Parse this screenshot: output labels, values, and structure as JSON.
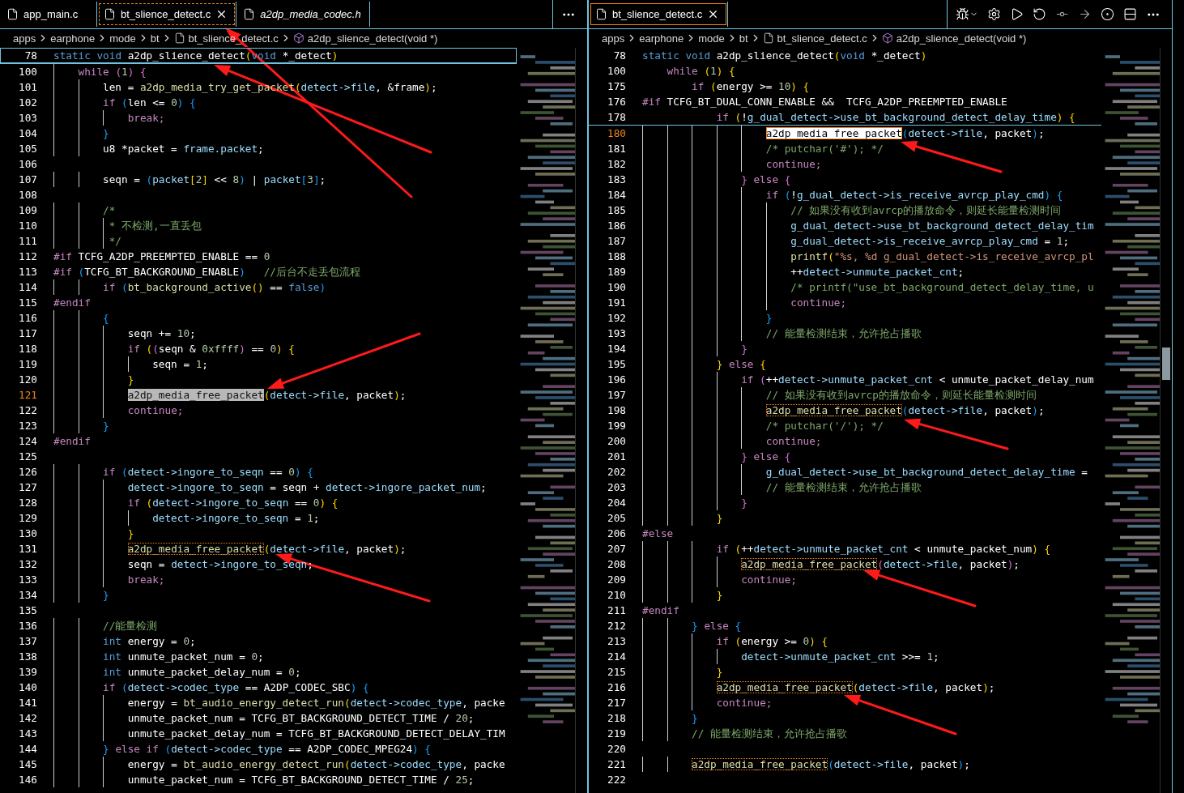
{
  "editor_groups": [
    {
      "focused": true,
      "tabs": [
        {
          "label": "app_main.c",
          "selected": false,
          "preview": false
        },
        {
          "label": "bt_slience_detect.c",
          "selected": true,
          "preview": false
        },
        {
          "label": "a2dp_media_codec.h",
          "selected": false,
          "preview": true
        }
      ],
      "actions": [
        {
          "kind": "more"
        }
      ],
      "breadcrumbs": [
        {
          "text": "apps",
          "kind": "folder"
        },
        {
          "text": "earphone",
          "kind": "folder"
        },
        {
          "text": "mode",
          "kind": "folder"
        },
        {
          "text": "bt",
          "kind": "folder"
        },
        {
          "text": "bt_slience_detect.c",
          "kind": "file"
        },
        {
          "text": "a2dp_slience_detect(void *)",
          "kind": "symbol"
        }
      ],
      "sticky_lines": [
        {
          "number": "78",
          "current": false,
          "tokens": [
            {
              "text": "static void",
              "kind": "kw"
            },
            {
              "text": " a2dp_slience_detect",
              "kind": "txt"
            },
            {
              "text": "(",
              "kind": "b1"
            },
            {
              "text": "void",
              "kind": "kw"
            },
            {
              "text": " *_detect",
              "kind": "txt"
            },
            {
              "text": ")",
              "kind": "b1"
            }
          ]
        }
      ],
      "lines": [
        {
          "number": "100",
          "current": false,
          "tokens": [
            {
              "text": "    while",
              "kind": "ctl"
            },
            {
              "text": " (",
              "kind": "b2"
            },
            {
              "text": "1",
              "kind": "num"
            },
            {
              "text": ") {",
              "kind": "b2"
            }
          ]
        },
        {
          "number": "101",
          "current": false,
          "tokens": [
            {
              "text": "        len = ",
              "kind": "txt"
            },
            {
              "text": "a2dp_media_try_get_packet",
              "kind": "fn"
            },
            {
              "text": "(",
              "kind": "b1"
            },
            {
              "text": "detect->file",
              "kind": "var"
            },
            {
              "text": ", &frame",
              "kind": "txt"
            },
            {
              "text": ")",
              "kind": "b1"
            },
            {
              "text": ";",
              "kind": "txt"
            }
          ]
        },
        {
          "number": "102",
          "current": false,
          "tokens": [
            {
              "text": "        if",
              "kind": "ctl"
            },
            {
              "text": " (",
              "kind": "b3"
            },
            {
              "text": "len <= ",
              "kind": "txt"
            },
            {
              "text": "0",
              "kind": "num"
            },
            {
              "text": ") {",
              "kind": "b3"
            }
          ]
        },
        {
          "number": "103",
          "current": false,
          "tokens": [
            {
              "text": "            break;",
              "kind": "ctl"
            }
          ]
        },
        {
          "number": "104",
          "current": false,
          "tokens": [
            {
              "text": "        }",
              "kind": "b3"
            }
          ]
        },
        {
          "number": "105",
          "current": false,
          "tokens": [
            {
              "text": "        u8 *packet = ",
              "kind": "txt"
            },
            {
              "text": "frame.packet",
              "kind": "var"
            },
            {
              "text": ";",
              "kind": "txt"
            }
          ]
        },
        {
          "number": "106",
          "current": false
        },
        {
          "number": "107",
          "current": false,
          "tokens": [
            {
              "text": "        seqn = ",
              "kind": "txt"
            },
            {
              "text": "(",
              "kind": "b3"
            },
            {
              "text": "packet",
              "kind": "var"
            },
            {
              "text": "[",
              "kind": "b1"
            },
            {
              "text": "2",
              "kind": "num"
            },
            {
              "text": "]",
              "kind": "b1"
            },
            {
              "text": " << ",
              "kind": "txt"
            },
            {
              "text": "8",
              "kind": "num"
            },
            {
              "text": ")",
              "kind": "b3"
            },
            {
              "text": " | ",
              "kind": "txt"
            },
            {
              "text": "packet",
              "kind": "var"
            },
            {
              "text": "[",
              "kind": "b3"
            },
            {
              "text": "3",
              "kind": "num"
            },
            {
              "text": "]",
              "kind": "b3"
            },
            {
              "text": ";",
              "kind": "txt"
            }
          ]
        },
        {
          "number": "108",
          "current": false
        },
        {
          "number": "109",
          "current": false,
          "tokens": [
            {
              "text": "        /*",
              "kind": "com"
            }
          ]
        },
        {
          "number": "110",
          "current": false,
          "tokens": [
            {
              "text": "         * 不检测,一直丢包",
              "kind": "com"
            }
          ]
        },
        {
          "number": "111",
          "current": false,
          "tokens": [
            {
              "text": "         */",
              "kind": "com"
            }
          ]
        },
        {
          "number": "112",
          "current": false,
          "tokens": [
            {
              "text": "#if",
              "kind": "pre"
            },
            {
              "text": " TCFG_A2DP_PREEMPTED_ENABLE == ",
              "kind": "txt"
            },
            {
              "text": "0",
              "kind": "num"
            }
          ]
        },
        {
          "number": "113",
          "current": false,
          "tokens": [
            {
              "text": "#if",
              "kind": "pre"
            },
            {
              "text": " (",
              "kind": "b3"
            },
            {
              "text": "TCFG_BT_BACKGROUND_ENABLE",
              "kind": "txt"
            },
            {
              "text": ")",
              "kind": "b3"
            },
            {
              "text": "   //后台不走丢包流程",
              "kind": "com"
            }
          ]
        },
        {
          "number": "114",
          "current": false,
          "tokens": [
            {
              "text": "        if",
              "kind": "ctl"
            },
            {
              "text": " (",
              "kind": "b3"
            },
            {
              "text": "bt_background_active",
              "kind": "fn"
            },
            {
              "text": "()",
              "kind": "b1"
            },
            {
              "text": " == ",
              "kind": "txt"
            },
            {
              "text": "false",
              "kind": "kw"
            },
            {
              "text": ")",
              "kind": "b3"
            }
          ]
        },
        {
          "number": "115",
          "current": false,
          "tokens": [
            {
              "text": "#endif",
              "kind": "pre"
            }
          ]
        },
        {
          "number": "116",
          "current": false,
          "tokens": [
            {
              "text": "        {",
              "kind": "b3"
            }
          ]
        },
        {
          "number": "117",
          "current": false,
          "tokens": [
            {
              "text": "            seqn += ",
              "kind": "txt"
            },
            {
              "text": "10",
              "kind": "num"
            },
            {
              "text": ";",
              "kind": "txt"
            }
          ]
        },
        {
          "number": "118",
          "current": false,
          "tokens": [
            {
              "text": "            if",
              "kind": "ctl"
            },
            {
              "text": " (",
              "kind": "b1"
            },
            {
              "text": "(",
              "kind": "b2"
            },
            {
              "text": "seqn & ",
              "kind": "txt"
            },
            {
              "text": "0xffff",
              "kind": "num"
            },
            {
              "text": ")",
              "kind": "b2"
            },
            {
              "text": " == ",
              "kind": "txt"
            },
            {
              "text": "0",
              "kind": "num"
            },
            {
              "text": ") {",
              "kind": "b1"
            }
          ]
        },
        {
          "number": "119",
          "current": false,
          "tokens": [
            {
              "text": "                seqn = ",
              "kind": "txt"
            },
            {
              "text": "1",
              "kind": "num"
            },
            {
              "text": ";",
              "kind": "txt"
            }
          ]
        },
        {
          "number": "120",
          "current": false,
          "tokens": [
            {
              "text": "            }",
              "kind": "b1"
            }
          ]
        },
        {
          "number": "121",
          "current": true,
          "tokens": [
            {
              "text": "            a2dp_media_free_packet",
              "kind": "sel"
            },
            {
              "text": "(",
              "kind": "b1"
            },
            {
              "text": "detect->file",
              "kind": "var"
            },
            {
              "text": ", packet",
              "kind": "txt"
            },
            {
              "text": ")",
              "kind": "b1"
            },
            {
              "text": ";",
              "kind": "txt"
            }
          ]
        },
        {
          "number": "122",
          "current": false,
          "tokens": [
            {
              "text": "            continue;",
              "kind": "ctl"
            }
          ]
        },
        {
          "number": "123",
          "current": false,
          "tokens": [
            {
              "text": "        }",
              "kind": "b3"
            }
          ]
        },
        {
          "number": "124",
          "current": false,
          "tokens": [
            {
              "text": "#endif",
              "kind": "pre"
            }
          ]
        },
        {
          "number": "125",
          "current": false
        },
        {
          "number": "126",
          "current": false,
          "tokens": [
            {
              "text": "        if",
              "kind": "ctl"
            },
            {
              "text": " (",
              "kind": "b3"
            },
            {
              "text": "detect->ingore_to_seqn",
              "kind": "var"
            },
            {
              "text": " == ",
              "kind": "txt"
            },
            {
              "text": "0",
              "kind": "num"
            },
            {
              "text": ") {",
              "kind": "b3"
            }
          ]
        },
        {
          "number": "127",
          "current": false,
          "tokens": [
            {
              "text": "            detect->ingore_to_seqn",
              "kind": "var"
            },
            {
              "text": " = seqn + ",
              "kind": "txt"
            },
            {
              "text": "detect->ingore_packet_num",
              "kind": "var"
            },
            {
              "text": ";",
              "kind": "txt"
            }
          ]
        },
        {
          "number": "128",
          "current": false,
          "tokens": [
            {
              "text": "            if",
              "kind": "ctl"
            },
            {
              "text": " (",
              "kind": "b1"
            },
            {
              "text": "detect->ingore_to_seqn",
              "kind": "var"
            },
            {
              "text": " == ",
              "kind": "txt"
            },
            {
              "text": "0",
              "kind": "num"
            },
            {
              "text": ") {",
              "kind": "b1"
            }
          ]
        },
        {
          "number": "129",
          "current": false,
          "tokens": [
            {
              "text": "                detect->ingore_to_seqn",
              "kind": "var"
            },
            {
              "text": " = ",
              "kind": "txt"
            },
            {
              "text": "1",
              "kind": "num"
            },
            {
              "text": ";",
              "kind": "txt"
            }
          ]
        },
        {
          "number": "130",
          "current": false,
          "tokens": [
            {
              "text": "            }",
              "kind": "b1"
            }
          ]
        },
        {
          "number": "131",
          "current": false,
          "tokens": [
            {
              "text": "            a2dp_media_free_packet",
              "kind": "match"
            },
            {
              "text": "(",
              "kind": "b1"
            },
            {
              "text": "detect->file",
              "kind": "var"
            },
            {
              "text": ", packet",
              "kind": "txt"
            },
            {
              "text": ")",
              "kind": "b1"
            },
            {
              "text": ";",
              "kind": "txt"
            }
          ]
        },
        {
          "number": "132",
          "current": false,
          "tokens": [
            {
              "text": "            seqn = ",
              "kind": "txt"
            },
            {
              "text": "detect->ingore_to_seqn",
              "kind": "var"
            },
            {
              "text": ";",
              "kind": "txt"
            }
          ]
        },
        {
          "number": "133",
          "current": false,
          "tokens": [
            {
              "text": "            break;",
              "kind": "ctl"
            }
          ]
        },
        {
          "number": "134",
          "current": false,
          "tokens": [
            {
              "text": "        }",
              "kind": "b3"
            }
          ]
        },
        {
          "number": "135",
          "current": false
        },
        {
          "number": "136",
          "current": false,
          "tokens": [
            {
              "text": "        //能量检测",
              "kind": "com"
            }
          ]
        },
        {
          "number": "137",
          "current": false,
          "tokens": [
            {
              "text": "        int",
              "kind": "kw"
            },
            {
              "text": " energy = ",
              "kind": "txt"
            },
            {
              "text": "0",
              "kind": "num"
            },
            {
              "text": ";",
              "kind": "txt"
            }
          ]
        },
        {
          "number": "138",
          "current": false,
          "tokens": [
            {
              "text": "        int",
              "kind": "kw"
            },
            {
              "text": " unmute_packet_num = ",
              "kind": "txt"
            },
            {
              "text": "0",
              "kind": "num"
            },
            {
              "text": ";",
              "kind": "txt"
            }
          ]
        },
        {
          "number": "139",
          "current": false,
          "tokens": [
            {
              "text": "        int",
              "kind": "kw"
            },
            {
              "text": " unmute_packet_delay_num = ",
              "kind": "txt"
            },
            {
              "text": "0",
              "kind": "num"
            },
            {
              "text": ";",
              "kind": "txt"
            }
          ]
        },
        {
          "number": "140",
          "current": false,
          "tokens": [
            {
              "text": "        if",
              "kind": "ctl"
            },
            {
              "text": " (",
              "kind": "b3"
            },
            {
              "text": "detect->codec_type",
              "kind": "var"
            },
            {
              "text": " == A2DP_CODEC_SBC",
              "kind": "txt"
            },
            {
              "text": ") {",
              "kind": "b3"
            }
          ]
        },
        {
          "number": "141",
          "current": false,
          "tokens": [
            {
              "text": "            energy = ",
              "kind": "txt"
            },
            {
              "text": "bt_audio_energy_detect_run",
              "kind": "fn"
            },
            {
              "text": "(",
              "kind": "b1"
            },
            {
              "text": "detect->codec_type",
              "kind": "var"
            },
            {
              "text": ", packe",
              "kind": "txt"
            }
          ]
        },
        {
          "number": "142",
          "current": false,
          "tokens": [
            {
              "text": "            unmute_packet_num = TCFG_BT_BACKGROUND_DETECT_TIME / ",
              "kind": "txt"
            },
            {
              "text": "20",
              "kind": "num"
            },
            {
              "text": ";",
              "kind": "txt"
            }
          ]
        },
        {
          "number": "143",
          "current": false,
          "tokens": [
            {
              "text": "            unmute_packet_delay_num = TCFG_BT_BACKGROUND_DETECT_DELAY_TIM",
              "kind": "txt"
            }
          ]
        },
        {
          "number": "144",
          "current": false,
          "tokens": [
            {
              "text": "        } ",
              "kind": "b3"
            },
            {
              "text": "else if",
              "kind": "ctl"
            },
            {
              "text": " (",
              "kind": "b3"
            },
            {
              "text": "detect->codec_type",
              "kind": "var"
            },
            {
              "text": " == A2DP_CODEC_MPEG24",
              "kind": "txt"
            },
            {
              "text": ") {",
              "kind": "b3"
            }
          ]
        },
        {
          "number": "145",
          "current": false,
          "tokens": [
            {
              "text": "            energy = ",
              "kind": "txt"
            },
            {
              "text": "bt_audio_energy_detect_run",
              "kind": "fn"
            },
            {
              "text": "(",
              "kind": "b1"
            },
            {
              "text": "detect->codec_type",
              "kind": "var"
            },
            {
              "text": ", packe",
              "kind": "txt"
            }
          ]
        },
        {
          "number": "146",
          "current": false,
          "tokens": [
            {
              "text": "            unmute_packet_num = TCFG_BT_BACKGROUND_DETECT_TIME / ",
              "kind": "txt"
            },
            {
              "text": "25",
              "kind": "num"
            },
            {
              "text": ";",
              "kind": "txt"
            }
          ]
        }
      ]
    },
    {
      "focused": false,
      "tabs": [
        {
          "label": "bt_slience_detect.c",
          "selected": true,
          "preview": false
        }
      ],
      "actions": [
        {
          "kind": "debug"
        },
        {
          "kind": "settings"
        },
        {
          "kind": "run"
        },
        {
          "kind": "restart"
        },
        {
          "kind": "step-over"
        },
        {
          "kind": "step-into"
        },
        {
          "kind": "timeline"
        },
        {
          "kind": "split"
        },
        {
          "kind": "more"
        }
      ],
      "breadcrumbs": [
        {
          "text": "apps",
          "kind": "folder"
        },
        {
          "text": "earphone",
          "kind": "folder"
        },
        {
          "text": "mode",
          "kind": "folder"
        },
        {
          "text": "bt",
          "kind": "folder"
        },
        {
          "text": "bt_slience_detect.c",
          "kind": "file"
        },
        {
          "text": "a2dp_slience_detect(void *)",
          "kind": "symbol"
        }
      ],
      "sticky_lines": [
        {
          "number": "78",
          "current": false,
          "tokens": [
            {
              "text": "static void",
              "kind": "kw"
            },
            {
              "text": " a2dp_slience_detect",
              "kind": "txt"
            },
            {
              "text": "(",
              "kind": "b1"
            },
            {
              "text": "void",
              "kind": "kw"
            },
            {
              "text": " *_detect",
              "kind": "txt"
            },
            {
              "text": ")",
              "kind": "b1"
            }
          ]
        },
        {
          "number": "100",
          "current": false,
          "tokens": [
            {
              "text": "    while",
              "kind": "ctl"
            },
            {
              "text": " (",
              "kind": "b1"
            },
            {
              "text": "1",
              "kind": "num"
            },
            {
              "text": ") {",
              "kind": "b1"
            }
          ]
        },
        {
          "number": "175",
          "current": false,
          "tokens": [
            {
              "text": "        if",
              "kind": "ctl"
            },
            {
              "text": " (",
              "kind": "b1"
            },
            {
              "text": "energy >= ",
              "kind": "txt"
            },
            {
              "text": "10",
              "kind": "num"
            },
            {
              "text": ") {",
              "kind": "b1"
            }
          ]
        },
        {
          "number": "176",
          "current": false,
          "tokens": [
            {
              "text": "#if",
              "kind": "pre"
            },
            {
              "text": " TCFG_BT_DUAL_CONN_ENABLE &&  TCFG_A2DP_PREEMPTED_ENABLE",
              "kind": "txt"
            }
          ]
        },
        {
          "number": "178",
          "current": false,
          "tokens": [
            {
              "text": "            if",
              "kind": "ctl"
            },
            {
              "text": " (",
              "kind": "b1"
            },
            {
              "text": "!",
              "kind": "txt"
            },
            {
              "text": "g_dual_detect->use_bt_background_detect_delay_time",
              "kind": "var"
            },
            {
              "text": ") {",
              "kind": "b1"
            }
          ]
        }
      ],
      "lines": [
        {
          "number": "180",
          "current": true,
          "tokens": [
            {
              "text": "                    a2dp_media_free_packet",
              "kind": "focus"
            },
            {
              "text": "(",
              "kind": "b3"
            },
            {
              "text": "detect->file",
              "kind": "var"
            },
            {
              "text": ", packet",
              "kind": "txt"
            },
            {
              "text": ")",
              "kind": "b3"
            },
            {
              "text": ";",
              "kind": "txt"
            }
          ]
        },
        {
          "number": "181",
          "current": false,
          "tokens": [
            {
              "text": "                    /* putchar('#'); */",
              "kind": "com"
            }
          ]
        },
        {
          "number": "182",
          "current": false,
          "tokens": [
            {
              "text": "                    continue;",
              "kind": "ctl"
            }
          ]
        },
        {
          "number": "183",
          "current": false,
          "tokens": [
            {
              "text": "                } ",
              "kind": "b2"
            },
            {
              "text": "else",
              "kind": "ctl"
            },
            {
              "text": " {",
              "kind": "b2"
            }
          ]
        },
        {
          "number": "184",
          "current": false,
          "tokens": [
            {
              "text": "                    if",
              "kind": "ctl"
            },
            {
              "text": " (",
              "kind": "b3"
            },
            {
              "text": "!",
              "kind": "txt"
            },
            {
              "text": "g_dual_detect->is_receive_avrcp_play_cmd",
              "kind": "var"
            },
            {
              "text": ") {",
              "kind": "b3"
            }
          ]
        },
        {
          "number": "185",
          "current": false,
          "tokens": [
            {
              "text": "                        // 如果没有收到avrcp的播放命令，则延长能量检测时间",
              "kind": "com"
            }
          ]
        },
        {
          "number": "186",
          "current": false,
          "tokens": [
            {
              "text": "                        g_dual_detect->use_bt_background_detect_delay_tim",
              "kind": "var"
            }
          ]
        },
        {
          "number": "187",
          "current": false,
          "tokens": [
            {
              "text": "                        g_dual_detect->is_receive_avrcp_play_cmd",
              "kind": "var"
            },
            {
              "text": " = ",
              "kind": "txt"
            },
            {
              "text": "1",
              "kind": "num"
            },
            {
              "text": ";",
              "kind": "txt"
            }
          ]
        },
        {
          "number": "188",
          "current": false,
          "tokens": [
            {
              "text": "                        printf",
              "kind": "fn"
            },
            {
              "text": "(",
              "kind": "b1"
            },
            {
              "text": "\"%s, %d g_dual_detect->is_receive_avrcp_pl",
              "kind": "str"
            }
          ]
        },
        {
          "number": "189",
          "current": false,
          "tokens": [
            {
              "text": "                        ++",
              "kind": "txt"
            },
            {
              "text": "detect->unmute_packet_cnt",
              "kind": "var"
            },
            {
              "text": ";",
              "kind": "txt"
            }
          ]
        },
        {
          "number": "190",
          "current": false,
          "tokens": [
            {
              "text": "                        /* printf(\"use_bt_background_detect_delay_time, u",
              "kind": "com"
            }
          ]
        },
        {
          "number": "191",
          "current": false,
          "tokens": [
            {
              "text": "                        continue;",
              "kind": "ctl"
            }
          ]
        },
        {
          "number": "192",
          "current": false,
          "tokens": [
            {
              "text": "                    }",
              "kind": "b3"
            }
          ]
        },
        {
          "number": "193",
          "current": false,
          "tokens": [
            {
              "text": "                    // 能量检测结束，允许抢占播歌",
              "kind": "com"
            }
          ]
        },
        {
          "number": "194",
          "current": false,
          "tokens": [
            {
              "text": "                }",
              "kind": "b2"
            }
          ]
        },
        {
          "number": "195",
          "current": false,
          "tokens": [
            {
              "text": "            } ",
              "kind": "b1"
            },
            {
              "text": "else",
              "kind": "ctl"
            },
            {
              "text": " {",
              "kind": "b1"
            }
          ]
        },
        {
          "number": "196",
          "current": false,
          "tokens": [
            {
              "text": "                if",
              "kind": "ctl"
            },
            {
              "text": " (",
              "kind": "b2"
            },
            {
              "text": "++",
              "kind": "txt"
            },
            {
              "text": "detect->unmute_packet_cnt",
              "kind": "var"
            },
            {
              "text": " < unmute_packet_delay_num",
              "kind": "txt"
            }
          ]
        },
        {
          "number": "197",
          "current": false,
          "tokens": [
            {
              "text": "                    // 如果没有收到avrcp的播放命令，则延长能量检测时间",
              "kind": "com"
            }
          ]
        },
        {
          "number": "198",
          "current": false,
          "tokens": [
            {
              "text": "                    a2dp_media_free_packet",
              "kind": "match"
            },
            {
              "text": "(",
              "kind": "b3"
            },
            {
              "text": "detect->file",
              "kind": "var"
            },
            {
              "text": ", packet",
              "kind": "txt"
            },
            {
              "text": ")",
              "kind": "b3"
            },
            {
              "text": ";",
              "kind": "txt"
            }
          ]
        },
        {
          "number": "199",
          "current": false,
          "tokens": [
            {
              "text": "                    /* putchar('/'); */",
              "kind": "com"
            }
          ]
        },
        {
          "number": "200",
          "current": false,
          "tokens": [
            {
              "text": "                    continue;",
              "kind": "ctl"
            }
          ]
        },
        {
          "number": "201",
          "current": false,
          "tokens": [
            {
              "text": "                } ",
              "kind": "b2"
            },
            {
              "text": "else",
              "kind": "ctl"
            },
            {
              "text": " {",
              "kind": "b2"
            }
          ]
        },
        {
          "number": "202",
          "current": false,
          "tokens": [
            {
              "text": "                    g_dual_detect->use_bt_background_detect_delay_time",
              "kind": "var"
            },
            {
              "text": " =",
              "kind": "txt"
            }
          ]
        },
        {
          "number": "203",
          "current": false,
          "tokens": [
            {
              "text": "                    // 能量检测结束，允许抢占播歌",
              "kind": "com"
            }
          ]
        },
        {
          "number": "204",
          "current": false,
          "tokens": [
            {
              "text": "                }",
              "kind": "b2"
            }
          ]
        },
        {
          "number": "205",
          "current": false,
          "tokens": [
            {
              "text": "            }",
              "kind": "b1"
            }
          ]
        },
        {
          "number": "206",
          "current": false,
          "tokens": [
            {
              "text": "#else",
              "kind": "pre"
            }
          ]
        },
        {
          "number": "207",
          "current": false,
          "tokens": [
            {
              "text": "            if",
              "kind": "ctl"
            },
            {
              "text": " (",
              "kind": "b1"
            },
            {
              "text": "++",
              "kind": "txt"
            },
            {
              "text": "detect->unmute_packet_cnt",
              "kind": "var"
            },
            {
              "text": " < unmute_packet_num",
              "kind": "txt"
            },
            {
              "text": ") {",
              "kind": "b1"
            }
          ]
        },
        {
          "number": "208",
          "current": false,
          "tokens": [
            {
              "text": "                a2dp_media_free_packet",
              "kind": "match"
            },
            {
              "text": "(",
              "kind": "b2"
            },
            {
              "text": "detect->file",
              "kind": "var"
            },
            {
              "text": ", packet",
              "kind": "txt"
            },
            {
              "text": ")",
              "kind": "b2"
            },
            {
              "text": ";",
              "kind": "txt"
            }
          ]
        },
        {
          "number": "209",
          "current": false,
          "tokens": [
            {
              "text": "                continue;",
              "kind": "ctl"
            }
          ]
        },
        {
          "number": "210",
          "current": false,
          "tokens": [
            {
              "text": "            }",
              "kind": "b1"
            }
          ]
        },
        {
          "number": "211",
          "current": false,
          "tokens": [
            {
              "text": "#endif",
              "kind": "pre"
            }
          ]
        },
        {
          "number": "212",
          "current": false,
          "tokens": [
            {
              "text": "        } ",
              "kind": "b3"
            },
            {
              "text": "else",
              "kind": "ctl"
            },
            {
              "text": " {",
              "kind": "b3"
            }
          ]
        },
        {
          "number": "213",
          "current": false,
          "tokens": [
            {
              "text": "            if",
              "kind": "ctl"
            },
            {
              "text": " (",
              "kind": "b1"
            },
            {
              "text": "energy >= ",
              "kind": "txt"
            },
            {
              "text": "0",
              "kind": "num"
            },
            {
              "text": ") {",
              "kind": "b1"
            }
          ]
        },
        {
          "number": "214",
          "current": false,
          "tokens": [
            {
              "text": "                detect->unmute_packet_cnt",
              "kind": "var"
            },
            {
              "text": " >>= ",
              "kind": "txt"
            },
            {
              "text": "1",
              "kind": "num"
            },
            {
              "text": ";",
              "kind": "txt"
            }
          ]
        },
        {
          "number": "215",
          "current": false,
          "tokens": [
            {
              "text": "            }",
              "kind": "b1"
            }
          ]
        },
        {
          "number": "216",
          "current": false,
          "tokens": [
            {
              "text": "            a2dp_media_free_packet",
              "kind": "match"
            },
            {
              "text": "(",
              "kind": "b1"
            },
            {
              "text": "detect->file",
              "kind": "var"
            },
            {
              "text": ", packet",
              "kind": "txt"
            },
            {
              "text": ")",
              "kind": "b1"
            },
            {
              "text": ";",
              "kind": "txt"
            }
          ]
        },
        {
          "number": "217",
          "current": false,
          "tokens": [
            {
              "text": "            continue;",
              "kind": "ctl"
            }
          ]
        },
        {
          "number": "218",
          "current": false,
          "tokens": [
            {
              "text": "        }",
              "kind": "b3"
            }
          ]
        },
        {
          "number": "219",
          "current": false,
          "tokens": [
            {
              "text": "        // 能量检测结束，允许抢占播歌",
              "kind": "com"
            }
          ]
        },
        {
          "number": "220",
          "current": false
        },
        {
          "number": "221",
          "current": false,
          "tokens": [
            {
              "text": "        a2dp_media_free_packet",
              "kind": "match"
            },
            {
              "text": "(",
              "kind": "b3"
            },
            {
              "text": "detect->file",
              "kind": "var"
            },
            {
              "text": ", packet",
              "kind": "txt"
            },
            {
              "text": ")",
              "kind": "b3"
            },
            {
              "text": ";",
              "kind": "txt"
            }
          ]
        },
        {
          "number": "222",
          "current": false
        }
      ]
    }
  ]
}
